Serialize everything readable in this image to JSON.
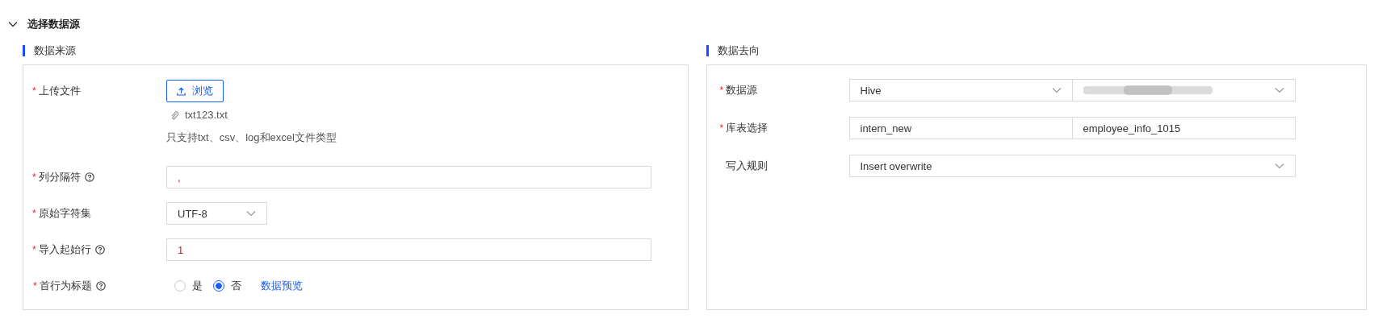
{
  "section": {
    "title": "选择数据源",
    "expanded": true
  },
  "source": {
    "title": "数据来源",
    "rows": [
      {
        "kind": "upload",
        "label": "上传文件",
        "mark": "*",
        "help": false,
        "button": "浏览",
        "file": "txt123.txt",
        "hint": "只支持txt、csv、log和excel文件类型"
      },
      {
        "kind": "input",
        "label": "列分隔符",
        "mark": "*",
        "help": true,
        "value": ","
      },
      {
        "kind": "select",
        "label": "原始字符集",
        "mark": "*",
        "help": false,
        "value": "UTF-8"
      },
      {
        "kind": "input",
        "label": "导入起始行",
        "mark": "*",
        "help": true,
        "value": "1"
      },
      {
        "kind": "radio",
        "label": "首行为标题",
        "mark": "*",
        "help": true,
        "options": [
          {
            "label": "是",
            "selected": false
          },
          {
            "label": "否",
            "selected": true
          }
        ],
        "link": "数据预览"
      }
    ]
  },
  "target": {
    "title": "数据去向",
    "rows": [
      {
        "kind": "pair",
        "label": "数据源",
        "mark": "*",
        "parts": [
          {
            "kind": "select",
            "value": "Hive"
          },
          {
            "kind": "redacted"
          }
        ]
      },
      {
        "kind": "pair",
        "label": "库表选择",
        "mark": "*",
        "parts": [
          {
            "kind": "input",
            "value": "intern_new"
          },
          {
            "kind": "input",
            "value": "employee_info_1015"
          }
        ]
      },
      {
        "kind": "wide-select",
        "label": "写入规则",
        "value": "Insert overwrite"
      }
    ]
  }
}
